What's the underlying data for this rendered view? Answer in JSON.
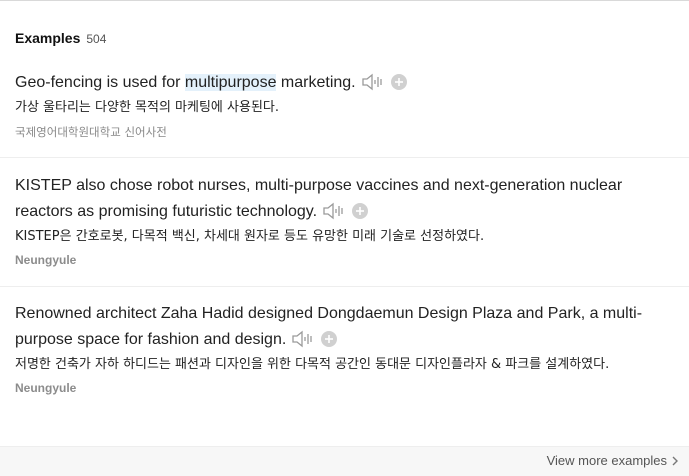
{
  "header": {
    "title": "Examples",
    "count": "504"
  },
  "examples": [
    {
      "en_before": "Geo-fencing is used for ",
      "en_highlight": "multipurpose",
      "en_after": " marketing.",
      "ko": "가상 울타리는 다양한 목적의 마케팅에 사용된다.",
      "source": "국제영어대학원대학교 신어사전"
    },
    {
      "en_before": "KISTEP also chose robot nurses, multi-purpose vaccines and next-generation nuclear reactors as promising futuristic technology.",
      "en_highlight": "",
      "en_after": "",
      "ko": "KISTEP은 간호로봇, 다목적 백신, 차세대 원자로 등도 유망한 미래 기술로 선정하였다.",
      "source": "Neungyule"
    },
    {
      "en_before": "Renowned architect Zaha Hadid designed Dongdaemun Design Plaza and Park, a multi-purpose space for fashion and design.",
      "en_highlight": "",
      "en_after": "",
      "ko": "저명한 건축가 자하 하디드는 패션과 디자인을 위한 다목적 공간인 동대문 디자인플라자 & 파크를 설계하였다.",
      "source": "Neungyule"
    }
  ],
  "footer": {
    "view_more": "View more examples"
  },
  "icons": {
    "sound": "speaker-icon",
    "add": "plus-circle-icon",
    "chevron": "chevron-right-icon"
  },
  "colors": {
    "highlight": "#e4f1fb",
    "icon_gray": "#9a9a9a",
    "footer_bg": "#f7f7f7"
  }
}
